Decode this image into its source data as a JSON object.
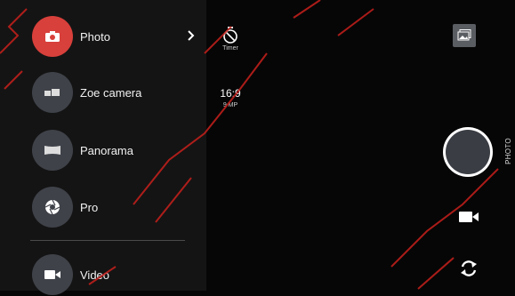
{
  "colors": {
    "background": "#060606",
    "panel": "#141414",
    "active_mode": "#d8403b",
    "mode_circle": "#3f4249",
    "watermark": "#c8201c"
  },
  "modes": [
    {
      "label": "Photo",
      "icon": "camera-icon",
      "active": true
    },
    {
      "label": "Zoe camera",
      "icon": "zoe-camera-icon",
      "active": false
    },
    {
      "label": "Panorama",
      "icon": "panorama-icon",
      "active": false
    },
    {
      "label": "Pro",
      "icon": "aperture-icon",
      "active": false
    },
    {
      "label": "Video",
      "icon": "video-icon",
      "active": false
    }
  ],
  "settings": {
    "timer_label": "Timer",
    "aspect_ratio": "16:9",
    "resolution": "9 MP"
  },
  "controls": {
    "mode_vertical_label": "PHOTO",
    "gallery_icon": "gallery-icon",
    "shutter_icon": "shutter-icon",
    "video_icon": "video-camera-icon",
    "switch_camera_icon": "switch-camera-icon"
  }
}
